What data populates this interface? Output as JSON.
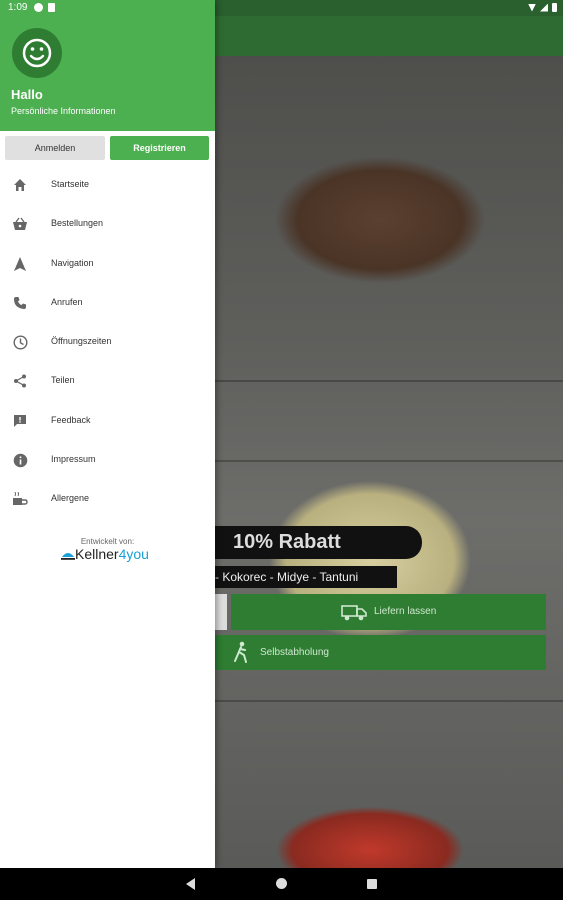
{
  "status_bar": {
    "time": "1:09"
  },
  "drawer": {
    "greeting": "Hallo",
    "subtitle": "Persönliche Informationen",
    "login_label": "Anmelden",
    "register_label": "Registrieren",
    "menu": [
      {
        "label": "Startseite",
        "icon": "home-icon"
      },
      {
        "label": "Bestellungen",
        "icon": "basket-icon"
      },
      {
        "label": "Navigation",
        "icon": "navigation-icon"
      },
      {
        "label": "Anrufen",
        "icon": "phone-icon"
      },
      {
        "label": "Öffnungszeiten",
        "icon": "clock-icon"
      },
      {
        "label": "Teilen",
        "icon": "share-icon"
      },
      {
        "label": "Feedback",
        "icon": "feedback-icon"
      },
      {
        "label": "Impressum",
        "icon": "info-icon"
      },
      {
        "label": "Allergene",
        "icon": "allergen-icon"
      }
    ],
    "developed_by": "Entwickelt von:",
    "brand": {
      "part1": "Kellner",
      "part2": "4you"
    }
  },
  "main": {
    "discount_banner": "10% Rabatt",
    "tags": "- Kokorec  - Midye - Tantuni",
    "delivery_button": "Liefern lassen",
    "pickup_button": "Selbstabholung"
  },
  "colors": {
    "primary": "#4caf50",
    "primary_dark": "#2e6b33",
    "button_green": "#2e7d32"
  }
}
